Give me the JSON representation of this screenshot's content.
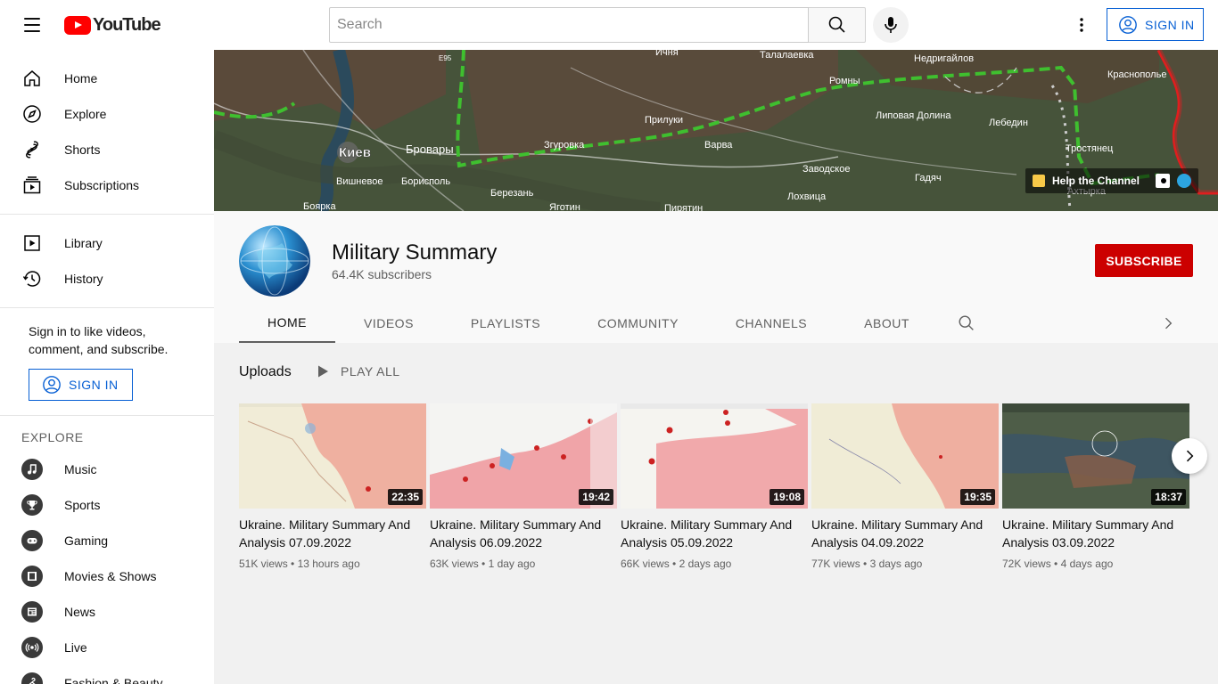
{
  "app": {
    "logo_text": "YouTube"
  },
  "topbar": {
    "search_placeholder": "Search",
    "sign_in": "SIGN IN"
  },
  "sidebar": {
    "primary": [
      {
        "label": "Home",
        "icon": "home-icon"
      },
      {
        "label": "Explore",
        "icon": "compass-icon"
      },
      {
        "label": "Shorts",
        "icon": "shorts-icon"
      },
      {
        "label": "Subscriptions",
        "icon": "subscriptions-icon"
      }
    ],
    "secondary": [
      {
        "label": "Library",
        "icon": "library-icon"
      },
      {
        "label": "History",
        "icon": "history-icon"
      }
    ],
    "signin_prompt": "Sign in to like videos, comment, and subscribe.",
    "sign_in": "SIGN IN",
    "explore_title": "EXPLORE",
    "explore": [
      {
        "label": "Music",
        "icon": "music-icon"
      },
      {
        "label": "Sports",
        "icon": "trophy-icon"
      },
      {
        "label": "Gaming",
        "icon": "gamepad-icon"
      },
      {
        "label": "Movies & Shows",
        "icon": "film-icon"
      },
      {
        "label": "News",
        "icon": "news-icon"
      },
      {
        "label": "Live",
        "icon": "live-icon"
      },
      {
        "label": "Fashion & Beauty",
        "icon": "hanger-icon"
      }
    ]
  },
  "banner": {
    "help_label": "Help the Channel",
    "map_labels": [
      "Киев",
      "Бровары",
      "Вишневое",
      "Борисполь",
      "Боярка",
      "Прилуки",
      "Згуровка",
      "Варва",
      "Ромны",
      "Талалаевка",
      "Недригайлов",
      "Ичня",
      "Заводское",
      "Лохвица",
      "Березань",
      "Яготин",
      "Пирятин",
      "Липовая Долина",
      "Лебедин",
      "Гадяч",
      "Тростянец",
      "Ахтырка",
      "Краснополье",
      "E95"
    ]
  },
  "channel": {
    "name": "Military Summary",
    "subscribers": "64.4K subscribers",
    "subscribe": "SUBSCRIBE",
    "tabs": [
      "HOME",
      "VIDEOS",
      "PLAYLISTS",
      "COMMUNITY",
      "CHANNELS",
      "ABOUT"
    ],
    "active_tab": "HOME"
  },
  "uploads": {
    "title": "Uploads",
    "play_all": "PLAY ALL",
    "videos": [
      {
        "title": "Ukraine. Military Summary And Analysis 07.09.2022",
        "views": "51K views",
        "age": "13 hours ago",
        "duration": "22:35"
      },
      {
        "title": "Ukraine. Military Summary And Analysis 06.09.2022",
        "views": "63K views",
        "age": "1 day ago",
        "duration": "19:42"
      },
      {
        "title": "Ukraine. Military Summary And Analysis 05.09.2022",
        "views": "66K views",
        "age": "2 days ago",
        "duration": "19:08"
      },
      {
        "title": "Ukraine. Military Summary And Analysis 04.09.2022",
        "views": "77K views",
        "age": "3 days ago",
        "duration": "19:35"
      },
      {
        "title": "Ukraine. Military Summary And Analysis 03.09.2022",
        "views": "72K views",
        "age": "4 days ago",
        "duration": "18:37"
      }
    ]
  },
  "colors": {
    "accent_blue": "#065fd4",
    "subscribe_red": "#cc0000",
    "youtube_red": "#ff0000"
  }
}
